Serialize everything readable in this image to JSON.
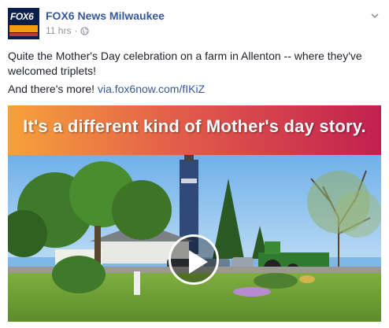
{
  "post": {
    "page_name": "FOX6 News Milwaukee",
    "timestamp": "11 hrs",
    "separator": "·",
    "privacy_icon": "globe-icon",
    "avatar_logo": "FOX6",
    "text_line1": "Quite the Mother's Day celebration on a farm in Allenton -- where they've welcomed triplets!",
    "text_line2_prefix": "And there's more! ",
    "link_text": "via.fox6now.com/fIKiZ",
    "menu_icon": "chevron-down-icon"
  },
  "video": {
    "banner_text": "It's a different kind of Mother's day story.",
    "play_icon": "play-icon"
  },
  "colors": {
    "link": "#365899",
    "meta": "#90949c",
    "banner_start": "#f6a23a",
    "banner_end": "#c2204f"
  }
}
